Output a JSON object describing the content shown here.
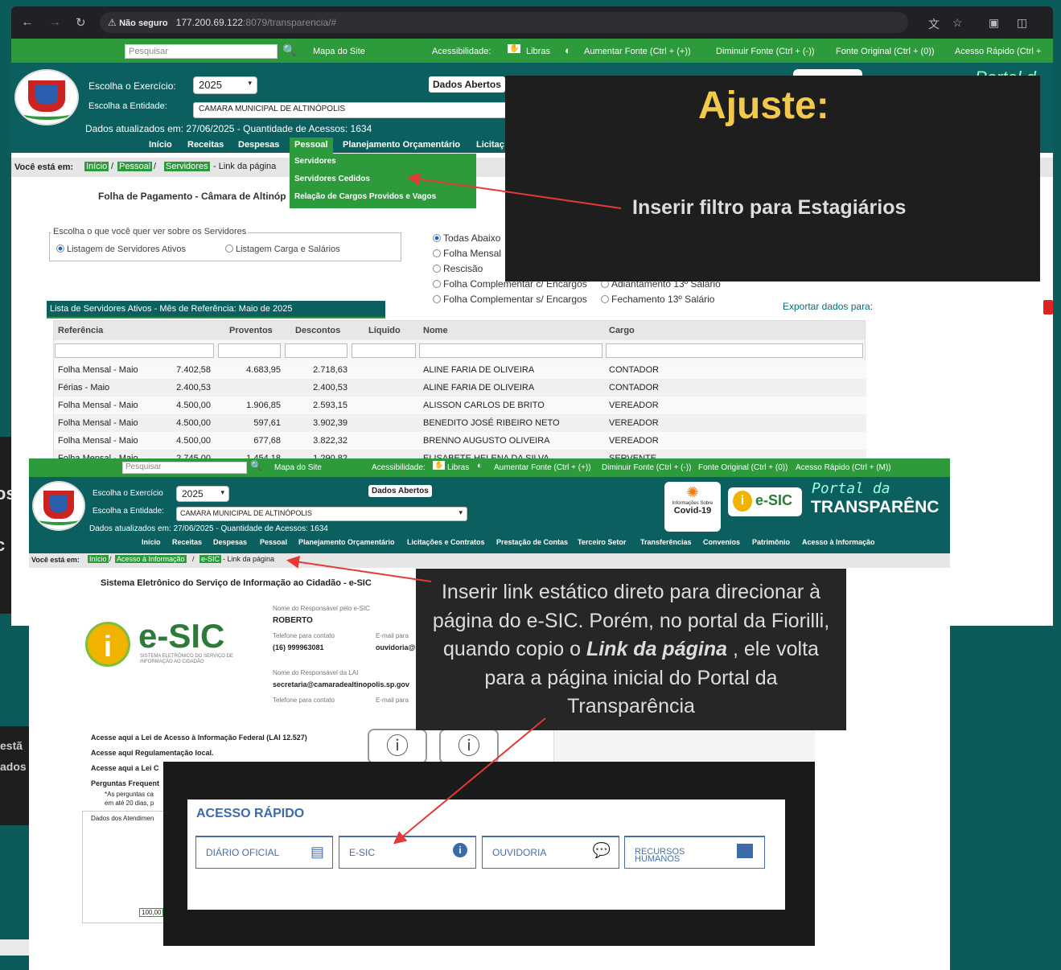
{
  "browser": {
    "not_secure": "Não seguro",
    "url_host": "177.200.69.122",
    "url_path": ":8079/transparencia/#"
  },
  "top_page": {
    "topbar": {
      "search_placeholder": "Pesquisar",
      "site_map": "Mapa do Site",
      "accessibility": "Acessibilidade:",
      "libras": "Libras",
      "increase_font": "Aumentar Fonte (Ctrl + (+))",
      "decrease_font": "Diminuir Fonte (Ctrl + (-))",
      "original_font": "Fonte Original (Ctrl + (0))",
      "quick_access": "Acesso Rápido (Ctrl +"
    },
    "header": {
      "exercise_label": "Escolha o Exercício:",
      "exercise_value": "2025",
      "entity_label": "Escolha a Entidade:",
      "entity_value": "CAMARA MUNICIPAL DE ALTINÓPOLIS",
      "updated": "Dados atualizados em: 27/06/2025 - Quantidade de Acessos: 1634",
      "open_data": "Dados Abertos"
    },
    "menu": [
      "Início",
      "Receitas",
      "Despesas",
      "Pessoal",
      "Planejamento Orçamentário",
      "Licitaç"
    ],
    "dropdown": [
      "Servidores",
      "Servidores Cedidos",
      "Relação de Cargos Providos e Vagos"
    ],
    "breadcrumb": {
      "label": "Você está em:",
      "items": [
        "Início",
        "Pessoal",
        "Servidores"
      ],
      "link": "- Link da página"
    },
    "heading": "Folha de Pagamento - Câmara de Altinóp",
    "filter_group_title": "Escolha o que você quer ver sobre os Servidores",
    "filter_options": [
      "Listagem de Servidores Ativos",
      "Listagem Carga e Salários"
    ],
    "type_options": [
      "Todas Abaixo",
      "Folha Mensal",
      "Rescisão",
      "Folha Complementar c/ Encargos",
      "Folha Complementar s/ Encargos"
    ],
    "type_options_col2": [
      "Adiantamento 13º Salário",
      "Fechamento 13º Salário"
    ],
    "list_title": "Lista de Servidores Ativos - Mês de Referência: Maio de 2025",
    "export_label": "Exportar dados para:",
    "table": {
      "headers": [
        "Referência",
        "Proventos",
        "Descontos",
        "Líquido",
        "Nome",
        "Cargo"
      ],
      "rows": [
        [
          "Folha Mensal - Maio",
          "7.402,58",
          "4.683,95",
          "2.718,63",
          "ALINE FARIA DE OLIVEIRA",
          "CONTADOR"
        ],
        [
          "Férias - Maio",
          "2.400,53",
          "",
          "2.400,53",
          "ALINE FARIA DE OLIVEIRA",
          "CONTADOR"
        ],
        [
          "Folha Mensal - Maio",
          "4.500,00",
          "1.906,85",
          "2.593,15",
          "ALISSON CARLOS DE BRITO",
          "VEREADOR"
        ],
        [
          "Folha Mensal - Maio",
          "4.500,00",
          "597,61",
          "3.902,39",
          "BENEDITO JOSÉ RIBEIRO NETO",
          "VEREADOR"
        ],
        [
          "Folha Mensal - Maio",
          "4.500,00",
          "677,68",
          "3.822,32",
          "BRENNO AUGUSTO OLIVEIRA",
          "VEREADOR"
        ],
        [
          "Folha Mensal - Maio",
          "2.745,00",
          "1.454,18",
          "1.290,82",
          "ELISABETE HELENA DA SILVA",
          "SERVENTE"
        ]
      ]
    },
    "portal_partial": "Portal d"
  },
  "callout1": {
    "title": "Ajuste:",
    "text": "Inserir filtro para Estagiários"
  },
  "bottom_page": {
    "topbar": {
      "search_placeholder": "Pesquisar",
      "site_map": "Mapa do Site",
      "accessibility": "Acessibilidade:",
      "libras": "Libras",
      "increase_font": "Aumentar Fonte (Ctrl + (+))",
      "decrease_font": "Diminuir Fonte (Ctrl + (-))",
      "original_font": "Fonte Original (Ctrl + (0))",
      "quick_access": "Acesso Rápido (Ctrl + (M))"
    },
    "header": {
      "exercise_label": "Escolha o Exercício",
      "exercise_value": "2025",
      "entity_label": "Escolha a Entidade:",
      "entity_value": "CAMARA MUNICIPAL DE ALTINÓPOLIS",
      "updated": "Dados atualizados em: 27/06/2025 - Quantidade de Acessos: 1634",
      "open_data": "Dados Abertos",
      "covid_small": "Informações Sobre",
      "covid": "Covid-19",
      "esic_badge": "e-SIC",
      "portal_top": "Portal da",
      "portal_bottom": "TRANSPARÊNC"
    },
    "menu": [
      "Início",
      "Receitas",
      "Despesas",
      "Pessoal",
      "Planejamento Orçamentário",
      "Licitações e Contratos",
      "Prestação de Contas",
      "Terceiro Setor",
      "Transferências",
      "Convenios",
      "Patrimônio",
      "Acesso à Informação"
    ],
    "breadcrumb": {
      "label": "Você está em:",
      "items": [
        "Início",
        "Acesso à Informação",
        "e-SIC"
      ],
      "link": "- Link da página"
    },
    "heading": "Sistema Eletrônico do Serviço de Informação ao Cidadão - e-SIC",
    "esic_logo": "e-SIC",
    "esic_logo_sub": "SISTEMA ELETRÔNICO DO SERVIÇO DE INFORMAÇÃO AO CIDADÃO",
    "resp_label": "Nome do Responsável pelo e-SIC",
    "resp_name": "ROBERTO",
    "phone_label": "Telefone para contato",
    "phone": "(16) 999963081",
    "email_label": "E-mail para",
    "email_partial": "ouvidoria@",
    "lai_label": "Nome do Responsável da LAI",
    "lai_email": "secretaria@camaradealtinopolis.sp.gov",
    "phone_label2": "Telefone para contato",
    "email_label2": "E-mail para",
    "links": [
      "Acesse aqui a Lei de Acesso à Informação Federal (LAI 12.527)",
      "Acesse aqui Regulamentação local.",
      "Acesse aqui a Lei C",
      "Perguntas Frequent"
    ],
    "note": "*As perguntas ca",
    "note2": "em até 20 dias, p",
    "chart_label": "Dados dos Atendimen",
    "chart_tick": "100,00"
  },
  "callout2": {
    "text_1": "Inserir link estático direto para direcionar à",
    "text_2": "página do e-SIC. Porém, no portal da Fiorilli,",
    "text_3a": "quando copio o ",
    "text_3b": "Link da página",
    "text_3c": " , ele volta",
    "text_4": "para a página inicial do Portal da",
    "text_5": "Transparência"
  },
  "quick_access": {
    "title": "ACESSO RÁPIDO",
    "items": [
      "DIÁRIO OFICIAL",
      "E-SIC",
      "OUVIDORIA",
      "RECURSOS HUMANOS"
    ]
  },
  "side_fragments": {
    "left_1": "os",
    "left_2": "i c",
    "left_3": "estã",
    "left_4": "ados"
  },
  "colors": {
    "green": "#2d9a3c",
    "teal": "#0c5f5f",
    "callout_bg": "#1e1e1e",
    "callout_title": "#f2c94c",
    "arrow": "#e53935"
  }
}
